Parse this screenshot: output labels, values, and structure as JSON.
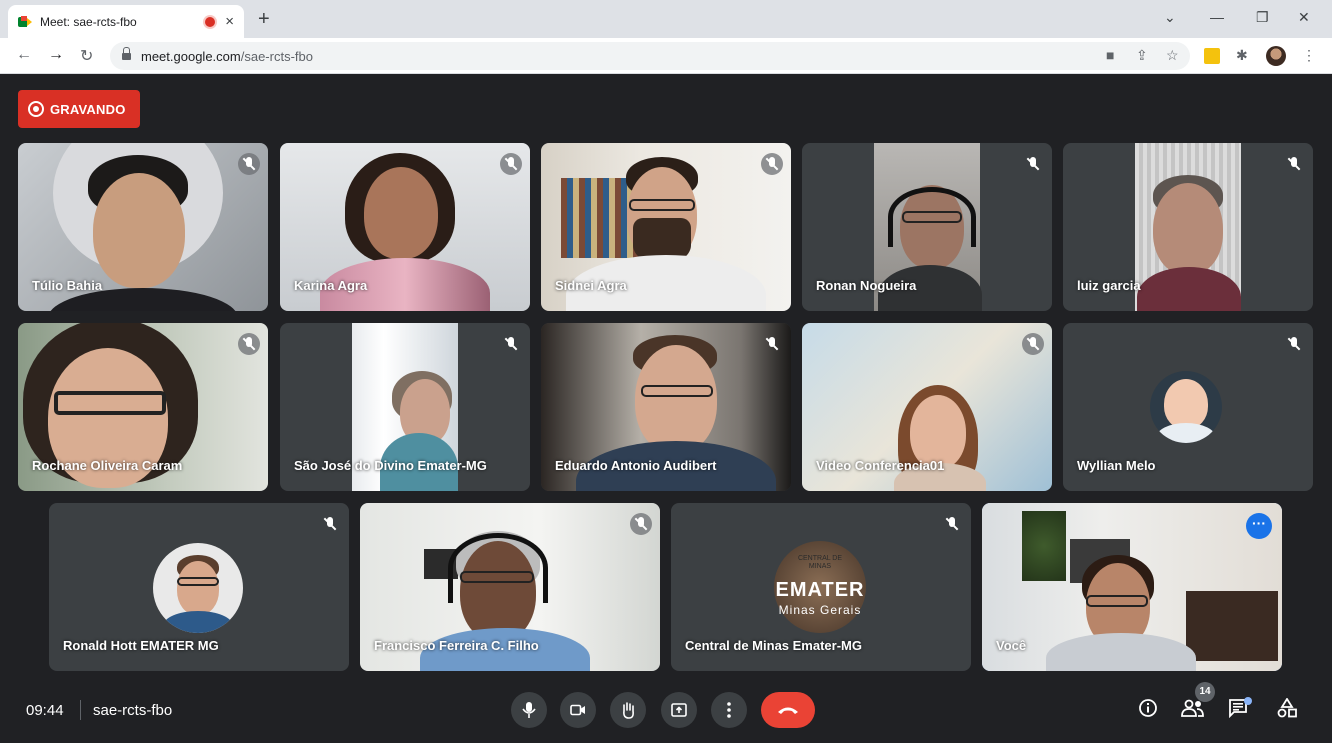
{
  "browser": {
    "tab_title": "Meet: sae-rcts-fbo",
    "tab_close": "×",
    "new_tab": "+",
    "url_host": "meet.google.com",
    "url_path": "/sae-rcts-fbo"
  },
  "recording": {
    "label": "GRAVANDO",
    "color": "#d93025"
  },
  "participants": [
    {
      "name": "Túlio Bahia",
      "muted": true
    },
    {
      "name": "Karina Agra",
      "muted": true
    },
    {
      "name": "Sidnei Agra",
      "muted": true
    },
    {
      "name": "Ronan Nogueira",
      "muted": true
    },
    {
      "name": "luiz garcia",
      "muted": true
    },
    {
      "name": "Rochane Oliveira Caram",
      "muted": true
    },
    {
      "name": "São José do Divino Emater-MG",
      "muted": true
    },
    {
      "name": "Eduardo Antonio Audibert",
      "muted": true
    },
    {
      "name": "Video Conferencia01",
      "muted": true
    },
    {
      "name": "Wyllian Melo",
      "muted": true
    },
    {
      "name": "Ronald Hott EMATER MG",
      "muted": true
    },
    {
      "name": "Francisco Ferreira C. Filho",
      "muted": true
    },
    {
      "name": "Central de Minas Emater-MG",
      "muted": true
    },
    {
      "name": "Você",
      "muted": false
    }
  ],
  "emater_logo": {
    "top": "CENTRAL DE",
    "top2": "MINAS",
    "brand": "EMATER",
    "sub": "Minas Gerais"
  },
  "meeting": {
    "time": "09:44",
    "code": "sae-rcts-fbo",
    "participant_count": "14"
  },
  "colors": {
    "accent": "#8ab4f8",
    "end_call": "#ea4335",
    "background": "#202124",
    "tile": "#3c4043"
  }
}
